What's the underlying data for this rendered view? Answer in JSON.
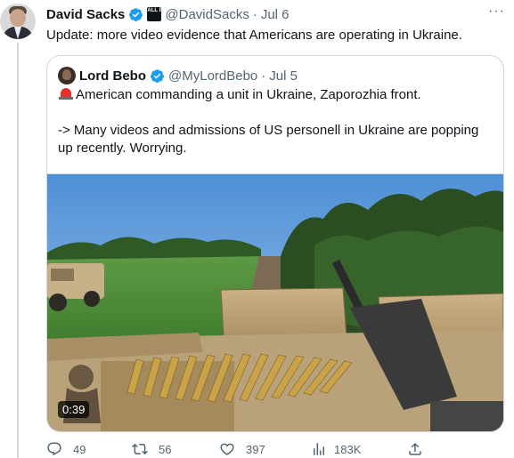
{
  "tweet": {
    "author_name": "David Sacks",
    "handle": "@DavidSacks",
    "separator": "·",
    "date": "Jul 6",
    "affiliate_badge": "ALL IN",
    "text": "Update: more video evidence that Americans are operating in Ukraine.",
    "more_label": "···"
  },
  "quoted": {
    "author_name": "Lord Bebo",
    "handle": "@MyLordBebo",
    "separator": "·",
    "date": "Jul 5",
    "line1": "American commanding a unit in Ukraine, Zaporozhia front.",
    "line2": "-> Many videos and admissions of US personell in Ukraine are popping",
    "line3": "up recently. Worrying.",
    "siren_icon": "police-car-light-emoji",
    "video_duration": "0:39"
  },
  "actions": {
    "replies": "49",
    "retweets": "56",
    "likes": "397",
    "views": "183K"
  },
  "colors": {
    "verified": "#1d9bf0",
    "muted": "#536471",
    "border": "#cfd9de"
  }
}
